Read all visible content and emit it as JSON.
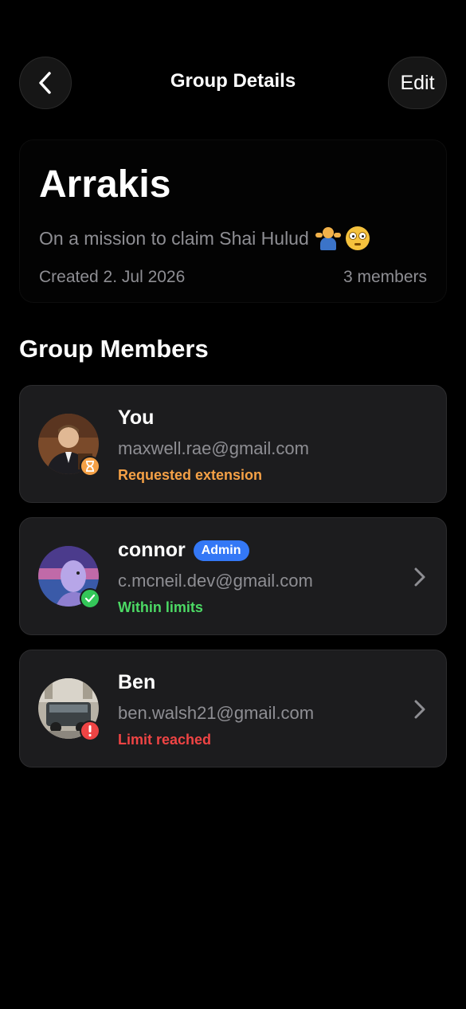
{
  "header": {
    "title": "Group Details",
    "edit_label": "Edit"
  },
  "group": {
    "name": "Arrakis",
    "description": "On a mission to claim Shai Hulud",
    "created": "Created 2. Jul 2026",
    "member_count": "3 members"
  },
  "section_title": "Group Members",
  "members": [
    {
      "name": "You",
      "email": "maxwell.rae@gmail.com",
      "status": "Requested extension",
      "status_color": "#f5a146",
      "status_icon": "hourglass-icon"
    },
    {
      "name": "connor",
      "badge": "Admin",
      "email": "c.mcneil.dev@gmail.com",
      "status": "Within limits",
      "status_color": "#4cd964",
      "status_icon": "checkmark-icon"
    },
    {
      "name": "Ben",
      "email": "ben.walsh21@gmail.com",
      "status": "Limit reached",
      "status_color": "#ef4444",
      "status_icon": "exclamation-icon"
    }
  ],
  "colors": {
    "accent_blue": "#3478f6",
    "card_bg": "#1c1c1e",
    "muted_text": "#8e8e93"
  }
}
